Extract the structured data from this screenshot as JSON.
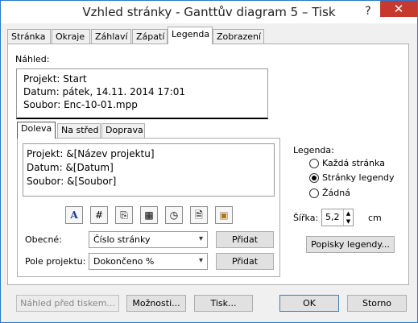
{
  "window": {
    "title": "Vzhled stránky - Ganttův diagram 5 – Tisk",
    "help": "?",
    "close": "✕"
  },
  "tabs": [
    {
      "label": "Stránka",
      "active": false
    },
    {
      "label": "Okraje",
      "active": false
    },
    {
      "label": "Záhlaví",
      "active": false
    },
    {
      "label": "Zápatí",
      "active": false
    },
    {
      "label": "Legenda",
      "active": true
    },
    {
      "label": "Zobrazení",
      "active": false
    }
  ],
  "preview": {
    "label": "Náhled:",
    "lines": [
      "Projekt: Start",
      "Datum: pátek, 14.11. 2014 17:01",
      "Soubor:  Enc-10-01.mpp"
    ]
  },
  "alignment_tabs": [
    {
      "label": "Doleva",
      "active": true
    },
    {
      "label": "Na střed",
      "active": false
    },
    {
      "label": "Doprava",
      "active": false
    }
  ],
  "editor": {
    "lines": [
      "Projekt: &[Název projektu]",
      "Datum: &[Datum]",
      "Soubor: &[Soubor]"
    ]
  },
  "toolbar": {
    "buttons": [
      {
        "icon": "font-format-icon",
        "glyph": "A"
      },
      {
        "icon": "page-number-icon",
        "glyph": "#"
      },
      {
        "icon": "total-pages-icon",
        "glyph": "⎘"
      },
      {
        "icon": "date-icon",
        "glyph": "▦"
      },
      {
        "icon": "time-icon",
        "glyph": "◷"
      },
      {
        "icon": "file-name-icon",
        "glyph": "🗎"
      },
      {
        "icon": "insert-picture-icon",
        "glyph": "▣"
      }
    ]
  },
  "general": {
    "label": "Obecné:",
    "value": "Číslo stránky",
    "add": "Přidat"
  },
  "project_field": {
    "label": "Pole projektu:",
    "value": "Dokončeno %",
    "add": "Přidat"
  },
  "legend": {
    "label": "Legenda:",
    "options": [
      {
        "label": "Každá stránka",
        "checked": false
      },
      {
        "label": "Stránky legendy",
        "checked": true
      },
      {
        "label": "Žádná",
        "checked": false
      }
    ]
  },
  "width": {
    "label": "Šířka:",
    "value": "5,2",
    "unit": "cm"
  },
  "legend_labels_button": "Popisky legendy...",
  "footer": {
    "print_preview": "Náhled před tiskem...",
    "options": "Možnosti...",
    "print": "Tisk...",
    "ok": "OK",
    "cancel": "Storno"
  }
}
